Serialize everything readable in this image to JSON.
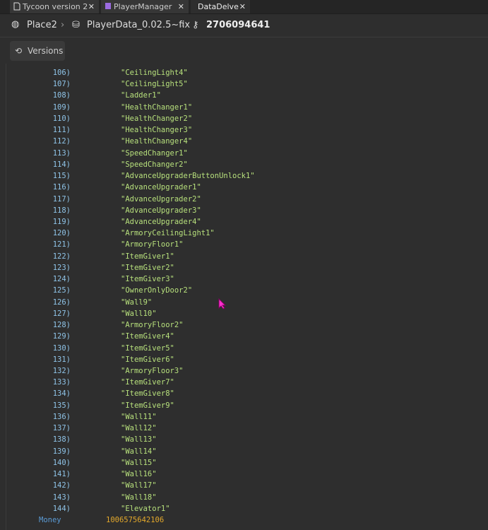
{
  "tabs": [
    {
      "label": "Tycoon version 2"
    },
    {
      "label": "PlayerManager"
    },
    {
      "label": "DataDelve"
    }
  ],
  "breadcrumb": {
    "place": "Place2",
    "datastore": "PlayerData_0.02.5~fix",
    "key": "2706094641"
  },
  "versions_label": "Versions",
  "entries": [
    {
      "i": "106)",
      "v": "\"CeilingLight4\""
    },
    {
      "i": "107)",
      "v": "\"CeilingLight5\""
    },
    {
      "i": "108)",
      "v": "\"Ladder1\""
    },
    {
      "i": "109)",
      "v": "\"HealthChanger1\""
    },
    {
      "i": "110)",
      "v": "\"HealthChanger2\""
    },
    {
      "i": "111)",
      "v": "\"HealthChanger3\""
    },
    {
      "i": "112)",
      "v": "\"HealthChanger4\""
    },
    {
      "i": "113)",
      "v": "\"SpeedChanger1\""
    },
    {
      "i": "114)",
      "v": "\"SpeedChanger2\""
    },
    {
      "i": "115)",
      "v": "\"AdvanceUpgraderButtonUnlock1\""
    },
    {
      "i": "116)",
      "v": "\"AdvanceUpgrader1\""
    },
    {
      "i": "117)",
      "v": "\"AdvanceUpgrader2\""
    },
    {
      "i": "118)",
      "v": "\"AdvanceUpgrader3\""
    },
    {
      "i": "119)",
      "v": "\"AdvanceUpgrader4\""
    },
    {
      "i": "120)",
      "v": "\"ArmoryCeilingLight1\""
    },
    {
      "i": "121)",
      "v": "\"ArmoryFloor1\""
    },
    {
      "i": "122)",
      "v": "\"ItemGiver1\""
    },
    {
      "i": "123)",
      "v": "\"ItemGiver2\""
    },
    {
      "i": "124)",
      "v": "\"ItemGiver3\""
    },
    {
      "i": "125)",
      "v": "\"OwnerOnlyDoor2\""
    },
    {
      "i": "126)",
      "v": "\"Wall9\""
    },
    {
      "i": "127)",
      "v": "\"Wall10\""
    },
    {
      "i": "128)",
      "v": "\"ArmoryFloor2\""
    },
    {
      "i": "129)",
      "v": "\"ItemGiver4\""
    },
    {
      "i": "130)",
      "v": "\"ItemGiver5\""
    },
    {
      "i": "131)",
      "v": "\"ItemGiver6\""
    },
    {
      "i": "132)",
      "v": "\"ArmoryFloor3\""
    },
    {
      "i": "133)",
      "v": "\"ItemGiver7\""
    },
    {
      "i": "134)",
      "v": "\"ItemGiver8\""
    },
    {
      "i": "135)",
      "v": "\"ItemGiver9\""
    },
    {
      "i": "136)",
      "v": "\"Wall11\""
    },
    {
      "i": "137)",
      "v": "\"Wall12\""
    },
    {
      "i": "138)",
      "v": "\"Wall13\""
    },
    {
      "i": "139)",
      "v": "\"Wall14\""
    },
    {
      "i": "140)",
      "v": "\"Wall15\""
    },
    {
      "i": "141)",
      "v": "\"Wall16\""
    },
    {
      "i": "142)",
      "v": "\"Wall17\""
    },
    {
      "i": "143)",
      "v": "\"Wall18\""
    },
    {
      "i": "144)",
      "v": "\"Elevator1\""
    }
  ],
  "money": {
    "key": "Money",
    "value": "1006575642106"
  },
  "colors": {
    "index": "#8fc4e8",
    "string": "#b7e07c",
    "key": "#5b9bd5",
    "number": "#e3a82b"
  }
}
